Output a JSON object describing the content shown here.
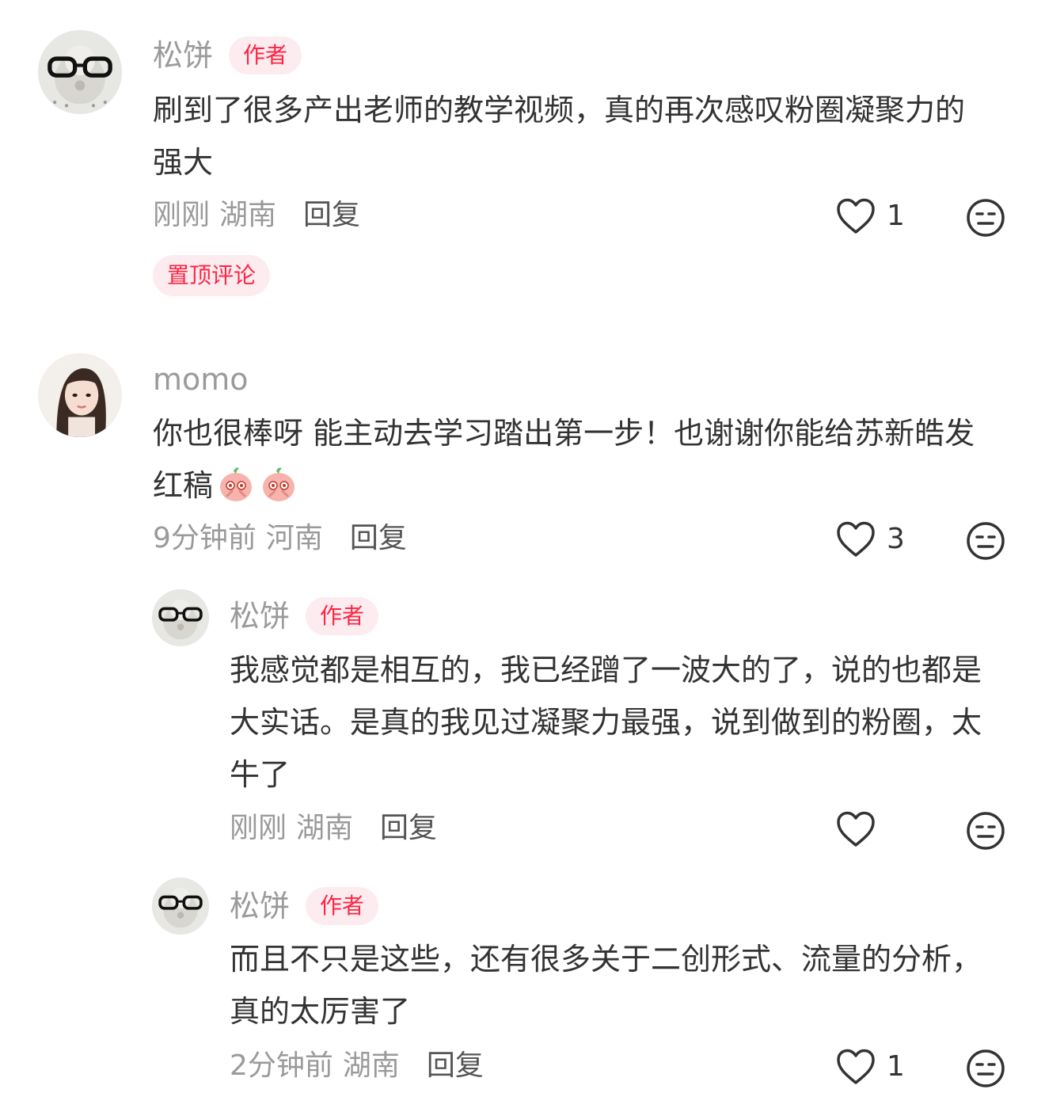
{
  "comments": [
    {
      "name": "松饼",
      "tag": "作者",
      "text": "刷到了很多产出老师的教学视频，真的再次感叹粉圈凝聚力的强大",
      "time": "刚刚",
      "location": "湖南",
      "reply": "回复",
      "likes": "1",
      "pinned": "置顶评论"
    },
    {
      "name": "momo",
      "text": "你也很棒呀 能主动去学习踏出第一步！也谢谢你能给苏新皓发红稿",
      "time": "9分钟前",
      "location": "河南",
      "reply": "回复",
      "likes": "3",
      "emoji_count": 2
    },
    {
      "name": "松饼",
      "tag": "作者",
      "text": "我感觉都是相互的，我已经蹭了一波大的了，说的也都是大实话。是真的我见过凝聚力最强，说到做到的粉圈，太牛了",
      "time": "刚刚",
      "location": "湖南",
      "reply": "回复",
      "likes": ""
    },
    {
      "name": "松饼",
      "tag": "作者",
      "text": "而且不只是这些，还有很多关于二创形式、流量的分析，真的太厉害了",
      "time": "2分钟前",
      "location": "湖南",
      "reply": "回复",
      "likes": "1"
    }
  ],
  "colors": {
    "accent": "#ff2442",
    "tag_bg": "#fdecef",
    "meta": "#9a9a9a",
    "text": "#333333"
  },
  "icons": {
    "like": "heart-outline-icon",
    "dislike": "meh-face-icon",
    "emoji": "peach-shy-emoji"
  }
}
